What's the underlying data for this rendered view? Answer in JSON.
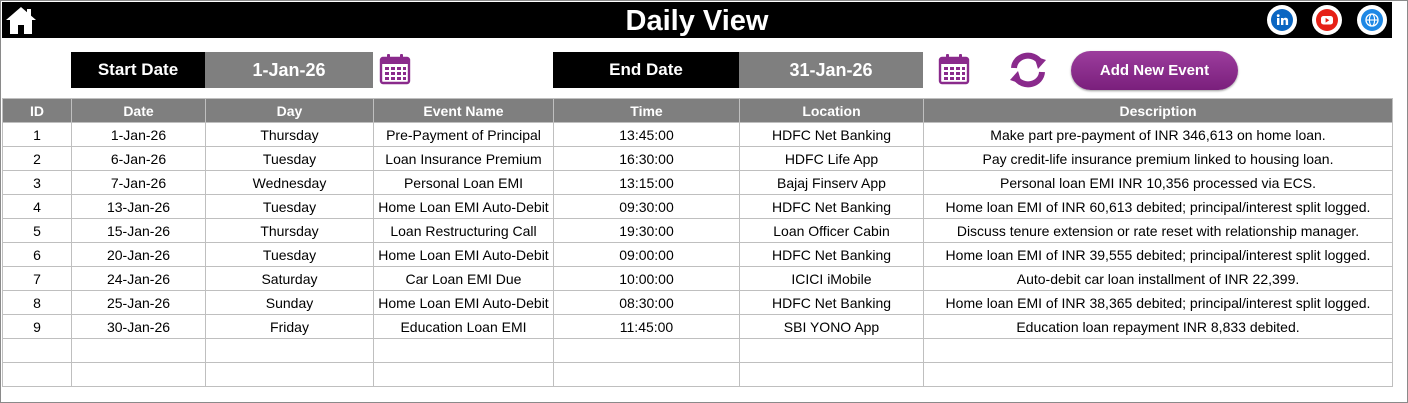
{
  "header": {
    "title": "Daily View",
    "home_icon": "home-icon",
    "social": [
      {
        "name": "linkedin-icon",
        "color": "#0a66c2",
        "glyph": "in"
      },
      {
        "name": "youtube-icon",
        "color": "#e62117",
        "glyph": "▶"
      },
      {
        "name": "globe-icon",
        "color": "#1e88e5",
        "glyph": "🌐"
      }
    ]
  },
  "filters": {
    "start_label": "Start Date",
    "start_value": "1-Jan-26",
    "end_label": "End Date",
    "end_value": "31-Jan-26",
    "calendar_icon": "calendar-icon",
    "refresh_icon": "refresh-icon",
    "accent_color": "#8a2a8c",
    "add_button": "Add New Event"
  },
  "table": {
    "columns": [
      "ID",
      "Date",
      "Day",
      "Event Name",
      "Time",
      "Location",
      "Description"
    ],
    "rows": [
      [
        "1",
        "1-Jan-26",
        "Thursday",
        "Pre-Payment of Principal",
        "13:45:00",
        "HDFC Net Banking",
        "Make part pre-payment of INR 346,613 on home loan."
      ],
      [
        "2",
        "6-Jan-26",
        "Tuesday",
        "Loan Insurance Premium",
        "16:30:00",
        "HDFC Life App",
        "Pay credit-life insurance premium linked to housing loan."
      ],
      [
        "3",
        "7-Jan-26",
        "Wednesday",
        "Personal Loan EMI",
        "13:15:00",
        "Bajaj Finserv App",
        "Personal loan EMI INR 10,356 processed via ECS."
      ],
      [
        "4",
        "13-Jan-26",
        "Tuesday",
        "Home Loan EMI Auto-Debit",
        "09:30:00",
        "HDFC Net Banking",
        "Home loan EMI of INR 60,613 debited; principal/interest split logged."
      ],
      [
        "5",
        "15-Jan-26",
        "Thursday",
        "Loan Restructuring Call",
        "19:30:00",
        "Loan Officer Cabin",
        "Discuss tenure extension or rate reset with relationship manager."
      ],
      [
        "6",
        "20-Jan-26",
        "Tuesday",
        "Home Loan EMI Auto-Debit",
        "09:00:00",
        "HDFC Net Banking",
        "Home loan EMI of INR 39,555 debited; principal/interest split logged."
      ],
      [
        "7",
        "24-Jan-26",
        "Saturday",
        "Car Loan EMI Due",
        "10:00:00",
        "ICICI iMobile",
        "Auto-debit car loan installment of INR 22,399."
      ],
      [
        "8",
        "25-Jan-26",
        "Sunday",
        "Home Loan EMI Auto-Debit",
        "08:30:00",
        "HDFC Net Banking",
        "Home loan EMI of INR 38,365 debited; principal/interest split logged."
      ],
      [
        "9",
        "30-Jan-26",
        "Friday",
        "Education Loan EMI",
        "11:45:00",
        "SBI YONO App",
        "Education loan repayment INR 8,833 debited."
      ],
      [
        "",
        "",
        "",
        "",
        "",
        "",
        ""
      ],
      [
        "",
        "",
        "",
        "",
        "",
        "",
        ""
      ]
    ]
  }
}
